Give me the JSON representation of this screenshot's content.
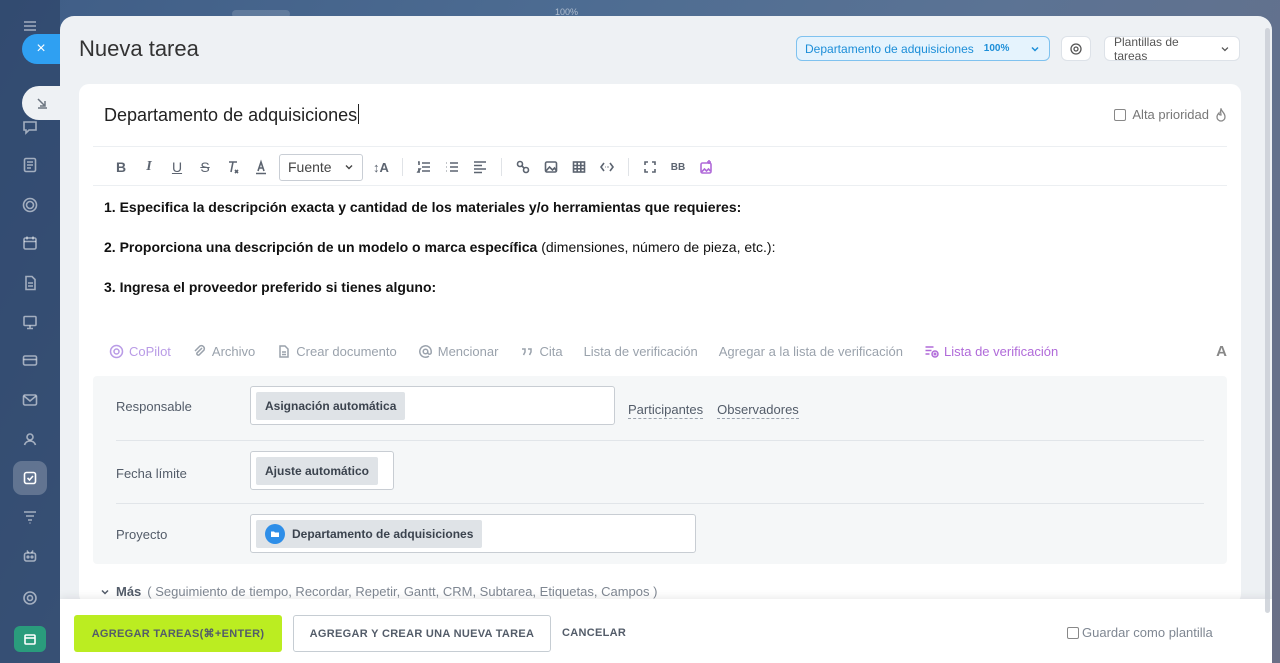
{
  "top_hint": "100%",
  "sidebar": {
    "close_label": "×"
  },
  "header": {
    "title": "Nueva tarea",
    "group_name": "Departamento de adquisiciones",
    "group_percent": "100%",
    "templates_label": "Plantillas de tareas"
  },
  "task": {
    "title": "Departamento de adquisiciones",
    "priority_label": "Alta prioridad",
    "priority_checked": false
  },
  "toolbar": {
    "bold": "B",
    "italic": "I",
    "underline": "U",
    "strike": "S",
    "font_select": "Fuente",
    "font_size": "↕A",
    "bbcode": "BB"
  },
  "description": {
    "line1": "1. Especifica la descripción exacta y cantidad de los materiales y/o herramientas que requieres:",
    "line2_bold": "2. Proporciona una descripción de un modelo o marca específica",
    "line2_rest": " (dimensiones, número de pieza, etc.):",
    "line3": "3. Ingresa el proveedor preferido si tienes alguno:"
  },
  "actions": {
    "copilot": "CoPilot",
    "file": "Archivo",
    "create_doc": "Crear documento",
    "mention": "Mencionar",
    "quote": "Cita",
    "checklist": "Lista de verificación",
    "add_to_checklist": "Agregar a la lista de verificación",
    "checklist_new": "Lista de verificación",
    "text_format": "A"
  },
  "fields": {
    "responsible_label": "Responsable",
    "responsible_value": "Asignación automática",
    "participants": "Participantes",
    "observers": "Observadores",
    "deadline_label": "Fecha límite",
    "deadline_value": "Ajuste automático",
    "project_label": "Proyecto",
    "project_value": "Departamento de adquisiciones"
  },
  "more": {
    "label": "Más",
    "items": "( Seguimiento de tiempo,  Recordar,  Repetir,  Gantt,  CRM,  Subtarea,  Etiquetas,  Campos )"
  },
  "footer": {
    "add_task": "AGREGAR TAREAS(⌘+ENTER)",
    "add_and_create": "AGREGAR Y CREAR UNA NUEVA TAREA",
    "cancel": "CANCELAR",
    "save_template": "Guardar como plantilla"
  },
  "colors": {
    "accent_blue": "#2fa0f2",
    "primary_button": "#bbed21",
    "purple": "#b06ad9"
  }
}
